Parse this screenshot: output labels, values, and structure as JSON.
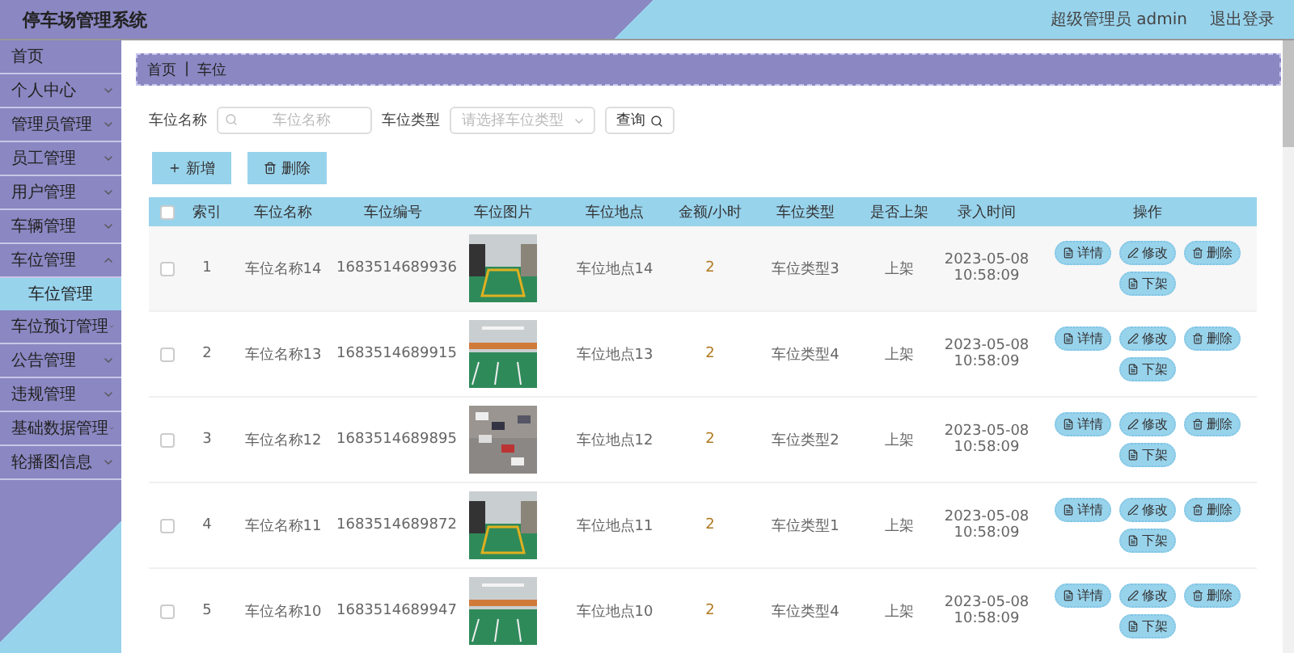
{
  "header": {
    "title": "停车场管理系统",
    "user": "超级管理员 admin",
    "logout": "退出登录"
  },
  "sidebar": {
    "items": [
      {
        "label": "首页"
      },
      {
        "label": "个人中心",
        "expanded": false
      },
      {
        "label": "管理员管理",
        "expanded": false
      },
      {
        "label": "员工管理",
        "expanded": false
      },
      {
        "label": "用户管理",
        "expanded": false
      },
      {
        "label": "车辆管理",
        "expanded": false
      },
      {
        "label": "车位管理",
        "expanded": true,
        "children": [
          {
            "label": "车位管理",
            "selected": true
          }
        ]
      },
      {
        "label": "车位预订管理",
        "expanded": false
      },
      {
        "label": "公告管理",
        "expanded": false
      },
      {
        "label": "违规管理",
        "expanded": false
      },
      {
        "label": "基础数据管理",
        "expanded": false
      },
      {
        "label": "轮播图信息",
        "expanded": false
      }
    ]
  },
  "breadcrumb": {
    "items": [
      "首页",
      "车位"
    ],
    "separator": "|"
  },
  "search": {
    "fields": [
      {
        "kind": "input",
        "label": "车位名称",
        "placeholder": "车位名称"
      },
      {
        "kind": "select",
        "label": "车位类型",
        "placeholder": "请选择车位类型"
      }
    ],
    "button": "查询"
  },
  "toolbar": [
    {
      "kind": "add",
      "label": "新增"
    },
    {
      "kind": "delete",
      "label": "删除"
    }
  ],
  "table": {
    "all_checked": false,
    "columns": [
      "索引",
      "车位名称",
      "车位编号",
      "车位图片",
      "车位地点",
      "金额/小时",
      "车位类型",
      "是否上架",
      "录入时间",
      "操作"
    ],
    "rows": [
      {
        "checked": false,
        "index": "1",
        "name": "车位名称14",
        "code": "1683514689936",
        "place": "车位地点14",
        "price": "2",
        "type": "车位类型3",
        "shelf": "上架",
        "time": "2023-05-08 10:58:09",
        "actions": [
          {
            "kind": "detail",
            "label": "详情"
          },
          {
            "kind": "edit",
            "label": "修改"
          },
          {
            "kind": "delete",
            "label": "删除"
          },
          {
            "kind": "off",
            "label": "下架"
          }
        ]
      },
      {
        "checked": false,
        "index": "2",
        "name": "车位名称13",
        "code": "1683514689915",
        "place": "车位地点13",
        "price": "2",
        "type": "车位类型4",
        "shelf": "上架",
        "time": "2023-05-08 10:58:09",
        "actions": [
          {
            "kind": "detail",
            "label": "详情"
          },
          {
            "kind": "edit",
            "label": "修改"
          },
          {
            "kind": "delete",
            "label": "删除"
          },
          {
            "kind": "off",
            "label": "下架"
          }
        ]
      },
      {
        "checked": false,
        "index": "3",
        "name": "车位名称12",
        "code": "1683514689895",
        "place": "车位地点12",
        "price": "2",
        "type": "车位类型2",
        "shelf": "上架",
        "time": "2023-05-08 10:58:09",
        "actions": [
          {
            "kind": "detail",
            "label": "详情"
          },
          {
            "kind": "edit",
            "label": "修改"
          },
          {
            "kind": "delete",
            "label": "删除"
          },
          {
            "kind": "off",
            "label": "下架"
          }
        ]
      },
      {
        "checked": false,
        "index": "4",
        "name": "车位名称11",
        "code": "1683514689872",
        "place": "车位地点11",
        "price": "2",
        "type": "车位类型1",
        "shelf": "上架",
        "time": "2023-05-08 10:58:09",
        "actions": [
          {
            "kind": "detail",
            "label": "详情"
          },
          {
            "kind": "edit",
            "label": "修改"
          },
          {
            "kind": "delete",
            "label": "删除"
          },
          {
            "kind": "off",
            "label": "下架"
          }
        ]
      },
      {
        "checked": false,
        "index": "5",
        "name": "车位名称10",
        "code": "1683514689947",
        "place": "车位地点10",
        "price": "2",
        "type": "车位类型4",
        "shelf": "上架",
        "time": "2023-05-08 10:58:09",
        "actions": [
          {
            "kind": "detail",
            "label": "详情"
          },
          {
            "kind": "edit",
            "label": "修改"
          },
          {
            "kind": "delete",
            "label": "删除"
          },
          {
            "kind": "off",
            "label": "下架"
          }
        ]
      }
    ]
  }
}
